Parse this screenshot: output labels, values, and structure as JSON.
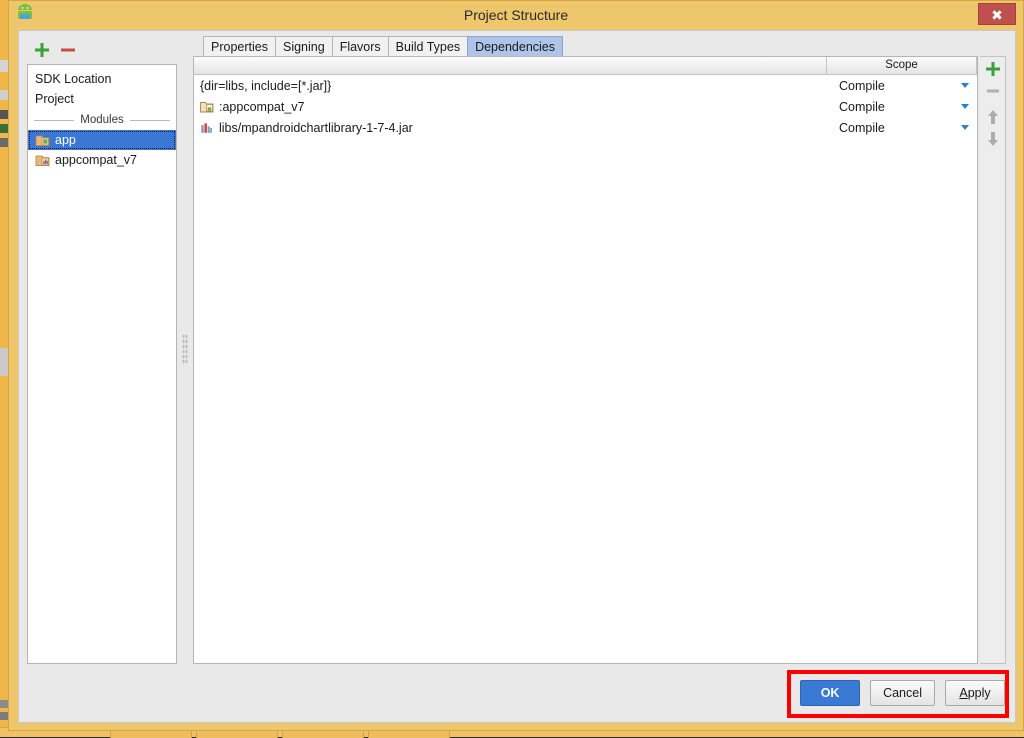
{
  "window": {
    "title": "Project Structure",
    "app_icon": "android-robot-icon",
    "close_label": "✖"
  },
  "modules_panel": {
    "toolbar": {
      "add_label": "+",
      "add_icon": "plus-icon",
      "remove_label": "−",
      "remove_icon": "minus-icon"
    },
    "items": [
      {
        "label": "SDK Location",
        "icon": null,
        "selected": false
      },
      {
        "label": "Project",
        "icon": null,
        "selected": false
      }
    ],
    "separator_label": "Modules",
    "modules": [
      {
        "label": "app",
        "icon": "module-android-icon",
        "selected": true
      },
      {
        "label": "appcompat_v7",
        "icon": "module-library-icon",
        "selected": false
      }
    ]
  },
  "tabs": [
    {
      "label": "Properties",
      "active": false
    },
    {
      "label": "Signing",
      "active": false
    },
    {
      "label": "Flavors",
      "active": false
    },
    {
      "label": "Build Types",
      "active": false
    },
    {
      "label": "Dependencies",
      "active": true
    }
  ],
  "dependencies_table": {
    "columns": [
      {
        "label": ""
      },
      {
        "label": "Scope"
      }
    ],
    "rows": [
      {
        "name": "{dir=libs, include=[*.jar]}",
        "icon": null,
        "scope": "Compile"
      },
      {
        "name": ":appcompat_v7",
        "icon": "module-folder-icon",
        "scope": "Compile"
      },
      {
        "name": "libs/mpandroidchartlibrary-1-7-4.jar",
        "icon": "jar-library-icon",
        "scope": "Compile"
      }
    ],
    "toolbar": [
      {
        "name": "add-dependency-button",
        "icon": "plus-icon",
        "enabled": true
      },
      {
        "name": "remove-dependency-button",
        "icon": "minus-icon",
        "enabled": false
      },
      {
        "name": "move-up-button",
        "icon": "arrow-up-icon",
        "enabled": true
      },
      {
        "name": "move-down-button",
        "icon": "arrow-down-icon",
        "enabled": true
      }
    ]
  },
  "footer": {
    "ok_label": "OK",
    "cancel_label": "Cancel",
    "apply_mnemonic": "A",
    "apply_rest": "pply"
  },
  "annotation": {
    "highlight_color": "#ff0000"
  }
}
